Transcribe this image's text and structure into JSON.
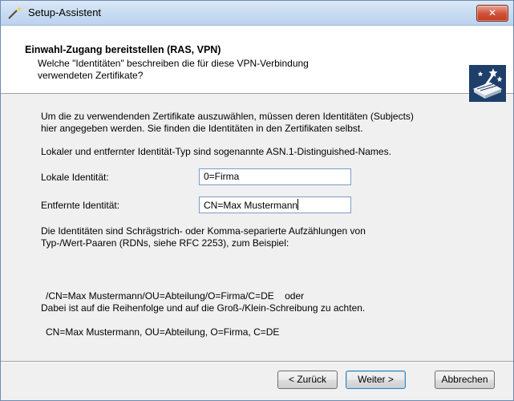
{
  "window": {
    "title": "Setup-Assistent",
    "close_glyph": "✕"
  },
  "header": {
    "title": "Einwahl-Zugang bereitstellen (RAS, VPN)",
    "subtitle_line1": "Welche \"Identitäten\" beschreiben die für diese VPN-Verbindung",
    "subtitle_line2": "verwendeten Zertifikate?",
    "logo_icon": "wizard-magic-icon"
  },
  "content": {
    "intro_line1": "Um die zu verwendenden Zertifikate auszuwählen, müssen deren Identitäten (Subjects)",
    "intro_line2": "hier angegeben werden. Sie finden die Identitäten in den Zertifikaten selbst.",
    "asn_note": "Lokaler und entfernter Identität-Typ sind sogenannte ASN.1-Distinguished-Names.",
    "local_identity_label": "Lokale Identität:",
    "local_identity_value": "0=Firma",
    "remote_identity_label": "Entfernte Identität:",
    "remote_identity_value": "CN=Max Mustermann",
    "explain_line1": "Die Identitäten sind Schrägstrich- oder Komma-separierte Aufzählungen von",
    "explain_line2": "Typ-/Wert-Paaren (RDNs, siehe RFC 2253), zum Beispiel:",
    "example_line1": "/CN=Max Mustermann/OU=Abteilung/O=Firma/C=DE    oder",
    "example_line2": "CN=Max Mustermann, OU=Abteilung, O=Firma, C=DE",
    "note": "Dabei ist auf die Reihenfolge und auf die Groß-/Klein-Schreibung zu achten."
  },
  "buttons": {
    "back": "< Zurück",
    "next": "Weiter >",
    "cancel": "Abbrechen"
  }
}
